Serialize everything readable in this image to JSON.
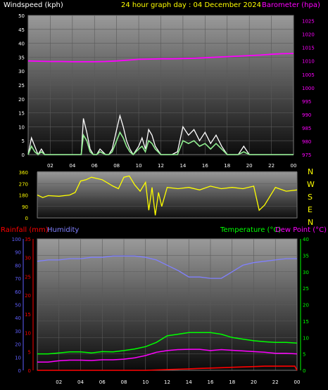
{
  "header": {
    "left_title": "Windspeed (kph)",
    "center_title": "24 hour graph day : 04 December 2024",
    "right_title": "Barometer (hpa)"
  },
  "bottom_header": {
    "rainfall": "Rainfall (mm)",
    "humidity": "Humidity",
    "temperature": "Temperature (°C)",
    "dewpoint": "Dew Point (°C)"
  },
  "compass": [
    "N",
    "W",
    "S",
    "E",
    "N"
  ],
  "colors": {
    "wind": "#ffffff",
    "gust": "#90ee90",
    "barometer": "#ff00ff",
    "direction": "#ffff00",
    "rain": "#ff0000",
    "humidity": "#8080ff",
    "temperature": "#00ff00",
    "dewpoint": "#ff00ff",
    "rain_axis": "#ff0000",
    "humidity_axis": "#6060ff",
    "temp_axis": "#00ff00"
  },
  "chart_data": [
    {
      "type": "line",
      "x_ticks": [
        "02",
        "04",
        "06",
        "08",
        "10",
        "12",
        "14",
        "16",
        "18",
        "20",
        "22",
        "00"
      ],
      "xlim_hours": [
        0,
        24
      ],
      "left_axis": {
        "ticks": [
          0,
          5,
          10,
          15,
          20,
          25,
          30,
          35,
          40,
          45,
          50
        ],
        "ylim": [
          0,
          50
        ]
      },
      "right_axis": {
        "ticks": [
          975,
          980,
          985,
          990,
          995,
          1000,
          1005,
          1010,
          1015,
          1020,
          1025
        ],
        "ylim": [
          975,
          1027
        ]
      },
      "series": [
        {
          "name": "Barometer (hpa)",
          "axis": "right",
          "x": [
            0,
            1,
            2,
            3,
            4,
            5,
            6,
            7,
            8,
            9,
            10,
            11,
            12,
            13,
            14,
            15,
            16,
            17,
            18,
            19,
            20,
            21,
            22,
            23,
            24
          ],
          "values": [
            1010.0,
            1009.9,
            1009.8,
            1009.8,
            1009.7,
            1009.7,
            1009.7,
            1009.8,
            1010.0,
            1010.3,
            1010.6,
            1010.7,
            1010.8,
            1010.8,
            1010.9,
            1011.0,
            1011.2,
            1011.4,
            1011.6,
            1011.8,
            1012.0,
            1012.2,
            1012.5,
            1012.7,
            1012.8
          ]
        },
        {
          "name": "Windspeed (kph) gust",
          "axis": "left",
          "x": [
            0,
            0.3,
            0.6,
            0.9,
            1.2,
            1.5,
            2,
            3,
            4,
            4.8,
            5,
            5.3,
            5.6,
            5.9,
            6.2,
            6.5,
            7,
            7.3,
            7.6,
            8,
            8.3,
            8.6,
            8.9,
            9.2,
            9.5,
            10,
            10.3,
            10.6,
            10.9,
            11.2,
            11.5,
            12,
            13,
            13.5,
            14,
            14.5,
            15,
            15.5,
            16,
            16.5,
            17,
            17.5,
            18,
            19,
            19.5,
            20,
            21,
            22,
            23,
            24
          ],
          "values": [
            0,
            6,
            3,
            0,
            2,
            0,
            0,
            0,
            0,
            0,
            13,
            8,
            2,
            0,
            0,
            2,
            0,
            0,
            2,
            9,
            14,
            10,
            5,
            2,
            0,
            3,
            6,
            2,
            9,
            7,
            3,
            0,
            0,
            1,
            10,
            7,
            9,
            5,
            8,
            4,
            7,
            3,
            0,
            0,
            3,
            0,
            0,
            0,
            0,
            0
          ]
        },
        {
          "name": "Windspeed (kph) average",
          "axis": "left",
          "x": [
            0,
            0.3,
            0.6,
            0.9,
            1.2,
            1.5,
            2,
            3,
            4,
            4.8,
            5,
            5.3,
            5.6,
            5.9,
            6.2,
            6.5,
            7,
            7.3,
            7.6,
            8,
            8.3,
            8.6,
            8.9,
            9.2,
            9.5,
            10,
            10.3,
            10.6,
            10.9,
            11.2,
            11.5,
            12,
            13,
            13.5,
            14,
            14.5,
            15,
            15.5,
            16,
            16.5,
            17,
            17.5,
            18,
            19,
            19.5,
            20,
            21,
            22,
            23,
            24
          ],
          "values": [
            0,
            3,
            1,
            0,
            1,
            0,
            0,
            0,
            0,
            0,
            7,
            5,
            1,
            0,
            0,
            1,
            0,
            0,
            1,
            5,
            8,
            6,
            3,
            1,
            0,
            2,
            3,
            1,
            5,
            4,
            2,
            0,
            0,
            0,
            5,
            4,
            5,
            3,
            4,
            2,
            4,
            2,
            0,
            0,
            1,
            0,
            0,
            0,
            0,
            0
          ]
        }
      ]
    },
    {
      "type": "line",
      "x_ticks": [
        "02",
        "04",
        "06",
        "08",
        "10",
        "12",
        "14",
        "16",
        "18",
        "20",
        "22",
        "00"
      ],
      "left_axis": {
        "ticks": [
          0,
          90,
          180,
          270,
          360
        ],
        "ylim": [
          0,
          360
        ]
      },
      "series": [
        {
          "name": "Wind direction",
          "x": [
            0,
            0.5,
            1,
            2,
            3,
            3.5,
            4,
            4.5,
            5,
            6,
            7,
            7.5,
            8,
            8.5,
            9,
            9.5,
            10,
            10.3,
            10.6,
            10.9,
            11.2,
            11.5,
            12,
            13,
            14,
            15,
            16,
            17,
            18,
            19,
            20,
            20.5,
            21,
            22,
            23,
            24
          ],
          "values": [
            180,
            160,
            175,
            170,
            180,
            200,
            290,
            300,
            320,
            300,
            250,
            230,
            320,
            330,
            260,
            210,
            280,
            60,
            240,
            20,
            200,
            90,
            240,
            230,
            240,
            220,
            250,
            230,
            240,
            230,
            250,
            60,
            100,
            240,
            210,
            220
          ]
        }
      ]
    },
    {
      "type": "line",
      "x_ticks": [
        "02",
        "04",
        "06",
        "08",
        "10",
        "12",
        "14",
        "16",
        "18",
        "20",
        "22",
        "00"
      ],
      "rain_axis": {
        "ticks": [
          0,
          5,
          10,
          15,
          20,
          25,
          30,
          35
        ],
        "ylim": [
          0,
          35
        ]
      },
      "humidity_axis": {
        "ticks": [
          0,
          10,
          20,
          30,
          40,
          50,
          60,
          70,
          80,
          90,
          100
        ],
        "ylim": [
          0,
          100
        ]
      },
      "temp_axis": {
        "ticks": [
          0,
          5,
          10,
          15,
          20,
          25,
          30,
          35,
          40
        ],
        "ylim": [
          0,
          40
        ]
      },
      "series": [
        {
          "name": "Humidity",
          "x": [
            0,
            1,
            2,
            3,
            4,
            5,
            6,
            7,
            8,
            9,
            10,
            11,
            12,
            13,
            14,
            15,
            16,
            17,
            18,
            19,
            20,
            21,
            22,
            23,
            24
          ],
          "values": [
            83,
            84,
            84,
            85,
            85,
            86,
            86,
            87,
            87,
            87,
            86,
            84,
            80,
            76,
            71,
            71,
            70,
            70,
            75,
            80,
            82,
            83,
            84,
            85,
            85
          ]
        },
        {
          "name": "Temperature (°C)",
          "x": [
            0,
            1,
            2,
            3,
            4,
            5,
            6,
            7,
            8,
            9,
            10,
            11,
            12,
            13,
            14,
            15,
            16,
            17,
            18,
            19,
            20,
            21,
            22,
            23,
            24
          ],
          "values": [
            5,
            5,
            5.3,
            5.6,
            5.6,
            5.3,
            5.7,
            5.6,
            6,
            6.5,
            7.2,
            8.5,
            10.5,
            11,
            11.5,
            11.5,
            11.5,
            11,
            10,
            9.5,
            9,
            8.7,
            8.5,
            8.5,
            8.3
          ]
        },
        {
          "name": "Dew Point (°C)",
          "x": [
            0,
            1,
            2,
            3,
            4,
            5,
            6,
            7,
            8,
            9,
            10,
            11,
            12,
            13,
            14,
            15,
            16,
            17,
            18,
            19,
            20,
            21,
            22,
            23,
            24
          ],
          "values": [
            2.5,
            2.5,
            2.9,
            3.1,
            3.1,
            3,
            3.2,
            3.2,
            3.4,
            3.8,
            4.5,
            5.5,
            6,
            6.3,
            6.4,
            6.4,
            6,
            6.3,
            6.1,
            5.9,
            5.7,
            5.5,
            5.2,
            5.2,
            5
          ]
        },
        {
          "name": "Rainfall (mm)",
          "x": [
            0,
            6,
            10,
            12,
            13,
            14,
            15,
            16,
            17,
            18,
            19,
            20,
            21,
            22,
            23,
            23.8,
            24
          ],
          "values": [
            0,
            0,
            0,
            0.2,
            0.3,
            0.4,
            0.5,
            0.6,
            0.7,
            0.8,
            0.9,
            1.0,
            1.1,
            1.1,
            1.1,
            1.1,
            0
          ]
        }
      ]
    }
  ]
}
